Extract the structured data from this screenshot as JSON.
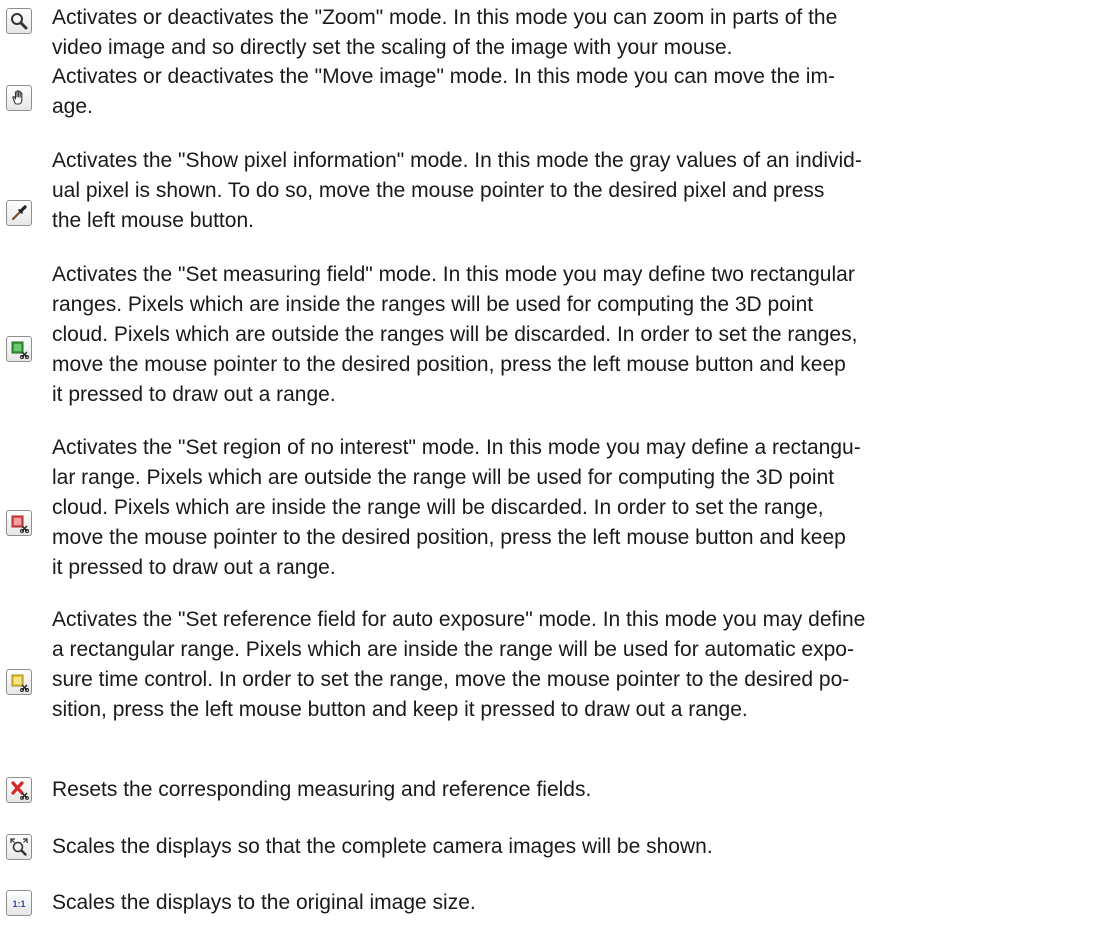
{
  "items": [
    {
      "icon": "zoom-icon",
      "lines": [
        "Activates or deactivates the \"Zoom\" mode. In this mode you can zoom in parts of the",
        "video image and so directly set the scaling of the image with your mouse."
      ]
    },
    {
      "icon": "hand-move-icon",
      "lines": [
        "Activates or deactivates the \"Move image\" mode. In this mode you can move the im-",
        "age."
      ]
    },
    {
      "icon": "eyedropper-icon",
      "lines": [
        "Activates the \"Show pixel information\" mode. In this mode the gray values of an individ-",
        "ual pixel is shown. To do so, move the mouse pointer to the desired pixel and press",
        "the left mouse button."
      ]
    },
    {
      "icon": "measuring-field-icon",
      "lines": [
        "Activates the \"Set measuring field\" mode. In this mode you may define two rectangular",
        "ranges. Pixels which are inside the ranges will be used for computing the 3D point",
        "cloud. Pixels which are outside the ranges will be discarded. In order to set the ranges,",
        "move the mouse pointer to the desired position, press the left mouse button and keep",
        "it pressed to draw out a range."
      ]
    },
    {
      "icon": "region-of-no-interest-icon",
      "lines": [
        "Activates the \"Set region of no interest\" mode. In this mode you may define a rectangu-",
        "lar range. Pixels which are outside the range will be used for computing the 3D point",
        "cloud. Pixels which are inside the range will be discarded. In order to set the range,",
        "move the mouse pointer to the desired position, press the left mouse button and keep",
        "it pressed to draw out a range."
      ]
    },
    {
      "icon": "auto-exposure-reference-icon",
      "lines": [
        "Activates the \"Set reference field for auto exposure\" mode. In this mode you may define",
        "a rectangular range. Pixels which are inside the range will be used for automatic expo-",
        "sure time control. In order to set the range, move the mouse pointer to the desired po-",
        "sition, press the left mouse button and keep it pressed to draw out a range."
      ]
    },
    {
      "icon": "reset-fields-icon",
      "lines": [
        "Resets the corresponding measuring and reference fields."
      ]
    },
    {
      "icon": "fit-to-window-icon",
      "lines": [
        "Scales the displays so that the complete camera images will be shown."
      ]
    },
    {
      "icon": "original-size-icon",
      "icon_text": "1:1",
      "lines": [
        "Scales the displays to the original image size."
      ]
    }
  ]
}
